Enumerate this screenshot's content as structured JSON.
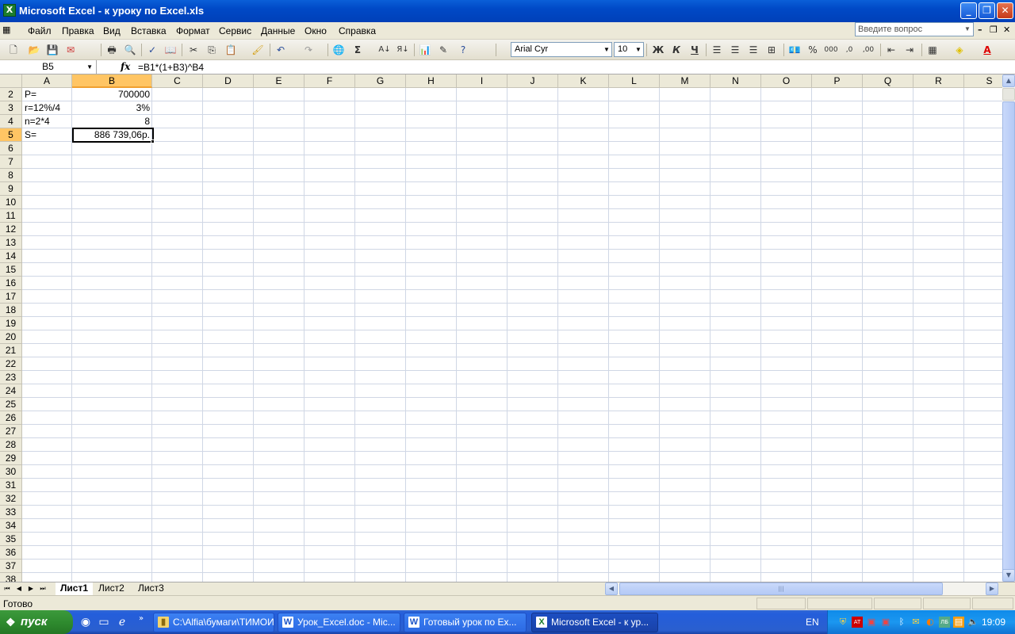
{
  "window": {
    "title": "Microsoft Excel - к уроку по Excel.xls",
    "controls": [
      "_",
      "❐",
      "✕"
    ]
  },
  "menu": {
    "items": [
      "Файл",
      "Правка",
      "Вид",
      "Вставка",
      "Формат",
      "Сервис",
      "Данные",
      "Окно",
      "Справка"
    ],
    "help_placeholder": "Введите вопрос"
  },
  "toolbar": {
    "font_name": "Arial Cyr",
    "font_size": "10",
    "bold": "Ж",
    "italic": "К",
    "underline": "Ч",
    "percent": "%",
    "thousands": "000"
  },
  "formula_bar": {
    "name_box": "B5",
    "fx": "fx",
    "formula": "=B1*(1+B3)^B4"
  },
  "sheet": {
    "columns": [
      "A",
      "B",
      "C",
      "D",
      "E",
      "F",
      "G",
      "H",
      "I",
      "J",
      "K",
      "L",
      "M",
      "N",
      "O",
      "P",
      "Q",
      "R",
      "S"
    ],
    "selected_column": "B",
    "rows": [
      "2",
      "3",
      "4",
      "5",
      "6",
      "7",
      "8",
      "9",
      "10",
      "11",
      "12",
      "13",
      "14",
      "15",
      "16",
      "17",
      "18",
      "19",
      "20",
      "21",
      "22",
      "23",
      "24",
      "25",
      "26",
      "27",
      "28",
      "29",
      "30",
      "31",
      "32",
      "33",
      "34",
      "35",
      "36",
      "37",
      "38"
    ],
    "selected_row": "5",
    "cells": {
      "A2": "P=",
      "B2": "700000",
      "A3": "r=12%/4",
      "B3": "3%",
      "A4": "n=2*4",
      "B4": "8",
      "A5": "S=",
      "B5": "886 739,06р."
    },
    "active_cell": "B5"
  },
  "tabs": {
    "items": [
      "Лист1",
      "Лист2",
      "Лист3"
    ],
    "active": "Лист1"
  },
  "status": {
    "text": "Готово"
  },
  "taskbar": {
    "start": "пуск",
    "tasks": [
      {
        "label": "C:\\Alfia\\бумаги\\ТИМОИ",
        "icon": "folder-icon",
        "active": false
      },
      {
        "label": "Урок_Excel.doc - Mic...",
        "icon": "word-icon",
        "active": false
      },
      {
        "label": "Готовый урок по Ex...",
        "icon": "word-icon",
        "active": false
      },
      {
        "label": "Microsoft Excel - к ур...",
        "icon": "excel-icon",
        "active": true
      }
    ],
    "language": "EN",
    "clock": "19:09"
  }
}
